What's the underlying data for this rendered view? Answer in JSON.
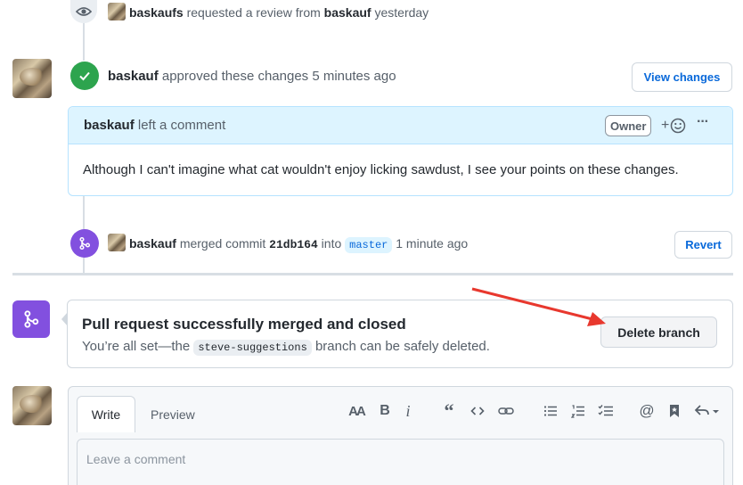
{
  "timeline": {
    "review_request": {
      "actor": "baskaufs",
      "action": "requested a review from",
      "target": "baskauf",
      "time": "yesterday"
    },
    "approval": {
      "actor": "baskauf",
      "action": "approved these changes",
      "time": "5 minutes ago",
      "button": "View changes"
    },
    "comment": {
      "author": "baskauf",
      "action": "left a comment",
      "role_badge": "Owner",
      "reaction_symbol": "+",
      "more_symbol": "···",
      "body": "Although I can't imagine what cat wouldn't enjoy licking sawdust, I see your points on these changes."
    },
    "merge_event": {
      "actor": "baskauf",
      "action": "merged commit",
      "commit": "21db164",
      "into": "into",
      "branch": "master",
      "time": "1 minute ago",
      "button": "Revert"
    }
  },
  "merge_status": {
    "title": "Pull request successfully merged and closed",
    "text_before": "You’re all set—the",
    "branch": "steve-suggestions",
    "text_after": "branch can be safely deleted.",
    "button": "Delete branch"
  },
  "editor": {
    "tab_write": "Write",
    "tab_preview": "Preview",
    "placeholder": "Leave a comment",
    "toolbar": {
      "heading": "AA",
      "bold": "B",
      "italic": "i"
    }
  },
  "colors": {
    "approved_green": "#2da44e",
    "merged_purple": "#8250df",
    "link_blue": "#0969da",
    "annotation_red": "#e8382e"
  }
}
